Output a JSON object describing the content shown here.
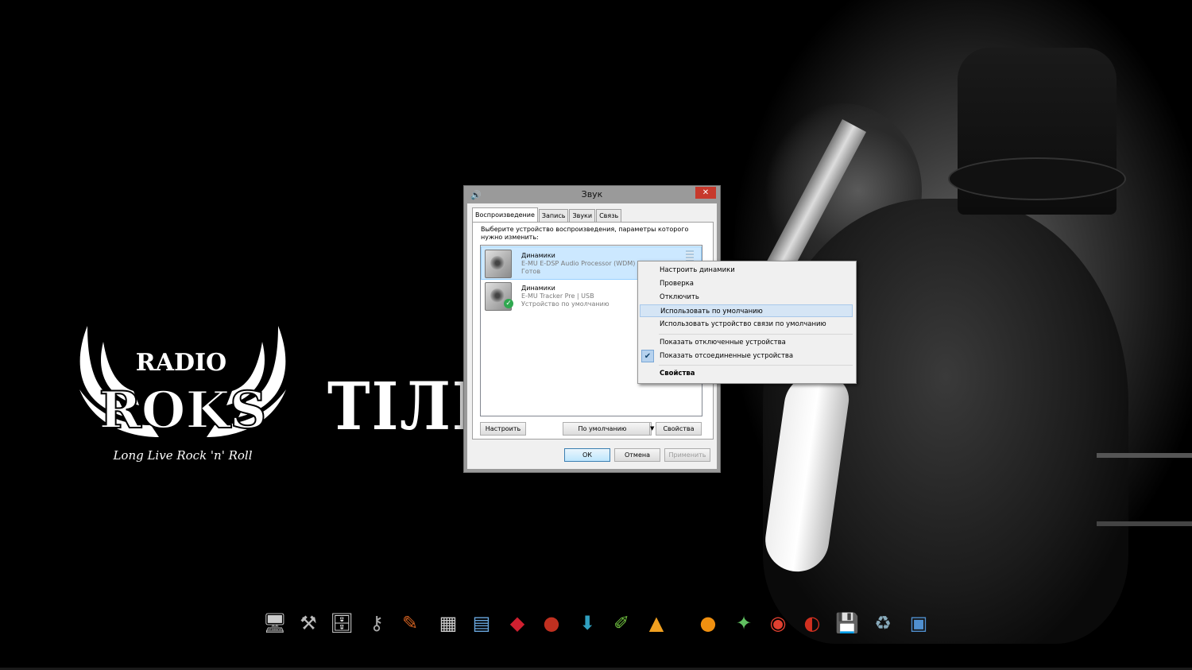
{
  "desktop": {
    "logo_radio": "RADIO",
    "logo_roks": "ROKS",
    "logo_tagline": "Long Live Rock 'n' Roll",
    "slogan": "ТІЛЬ"
  },
  "dialog": {
    "title": "Звук",
    "close_glyph": "✕",
    "tabs": [
      "Воспроизведение",
      "Запись",
      "Звуки",
      "Связь"
    ],
    "instructions": "Выберите устройство воспроизведения, параметры которого нужно изменить:",
    "devices": [
      {
        "name": "Динамики",
        "driver": "E-MU E-DSP Audio Processor (WDM)",
        "status": "Готов"
      },
      {
        "name": "Динамики",
        "driver": "E-MU Tracker Pre | USB",
        "status": "Устройство по умолчанию"
      }
    ],
    "configure_button": "Настроить",
    "default_button": "По умолчанию",
    "properties_button": "Свойства",
    "ok_button": "ОК",
    "cancel_button": "Отмена",
    "apply_button": "Применить"
  },
  "context_menu": {
    "items": [
      "Настроить динамики",
      "Проверка",
      "Отключить",
      "Использовать по умолчанию",
      "Использовать устройство связи по умолчанию",
      "Показать отключенные устройства",
      "Показать отсоединенные устройства",
      "Свойства"
    ],
    "highlighted": "Использовать по умолчанию",
    "checked": "Показать отсоединенные устройства"
  },
  "dock": {
    "icons": [
      "monitor-icon",
      "tools-icon",
      "computer-icon",
      "key-icon",
      "pencil-icon",
      "calculator-icon",
      "calc-window-icon",
      "arrow-icon",
      "microphone-icon",
      "download-icon",
      "graphics-icon",
      "aimp-icon",
      "quick-icon",
      "sim-icon",
      "chrome-icon",
      "ccleaner-icon",
      "floppy-icon",
      "recycle-bin-icon",
      "display-icon"
    ]
  },
  "colors": {
    "close": "#c7392c",
    "selection": "#cce8ff",
    "menu_highlight": "#d5e5f5"
  }
}
